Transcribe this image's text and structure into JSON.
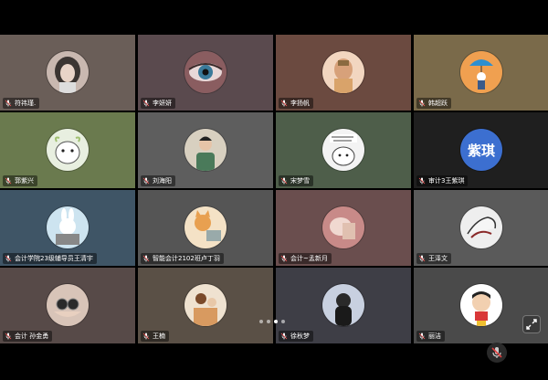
{
  "participants": [
    {
      "name": "符祎瑾.",
      "bg": "#6a5e58",
      "avatar": "portrait-photo",
      "avatar_color": "#3b3532"
    },
    {
      "name": "李妍妍",
      "bg": "#5a4a4e",
      "avatar": "eye-closeup",
      "avatar_color": "#8a5d60"
    },
    {
      "name": "李扬帆",
      "bg": "#6b4a40",
      "avatar": "cartoon-character",
      "avatar_color": "#d9a36a"
    },
    {
      "name": "韩超跃",
      "bg": "#7a6a4a",
      "avatar": "umbrella-figure",
      "avatar_color": "#f0a050"
    },
    {
      "name": "郭紫兴",
      "bg": "#6a7a4e",
      "avatar": "sheep-cartoon",
      "avatar_color": "#e8efe0"
    },
    {
      "name": "刘海阳",
      "bg": "#5e5e5e",
      "avatar": "man-illustration",
      "avatar_color": "#d8d0c0"
    },
    {
      "name": "宋梦雪",
      "bg": "#4e5e4a",
      "avatar": "cat-meme",
      "avatar_color": "#f3f3f3"
    },
    {
      "name": "审计3王紫琪",
      "bg": "#1f1f1f",
      "avatar": "text",
      "avatar_text": "紫琪",
      "avatar_color": "#3c6fd0"
    },
    {
      "name": "会计学院23级辅导员王清宇",
      "bg": "#3f5566",
      "avatar": "bunny-laptop",
      "avatar_color": "#cde4f0"
    },
    {
      "name": "智能会计2102班卢丁羽",
      "bg": "#555555",
      "avatar": "cat-laptop",
      "avatar_color": "#f4e2c6"
    },
    {
      "name": "会计~孟新月",
      "bg": "#6a4e4e",
      "avatar": "hand-photo",
      "avatar_color": "#c88a88"
    },
    {
      "name": "王泽文",
      "bg": "#5a5a5a",
      "avatar": "sketch-hand",
      "avatar_color": "#eeeeee"
    },
    {
      "name": "会计 孙金勇",
      "bg": "#574a48",
      "avatar": "goggles-photo",
      "avatar_color": "#d8c4b8"
    },
    {
      "name": "王楠",
      "bg": "#5a5046",
      "avatar": "family-photo",
      "avatar_color": "#d89a60"
    },
    {
      "name": "徐秋梦",
      "bg": "#3e3e46",
      "avatar": "back-view-photo",
      "avatar_color": "#c8d0e0"
    },
    {
      "name": "丽洁",
      "bg": "#4a4a4a",
      "avatar": "crayon-kid",
      "avatar_color": "#ffffff"
    }
  ],
  "pager": {
    "pages": 4,
    "current": 3
  },
  "controls": {
    "expand_icon": "expand-view-icon",
    "mute_icon": "microphone-muted-icon"
  },
  "mic_icon": "microphone-icon"
}
